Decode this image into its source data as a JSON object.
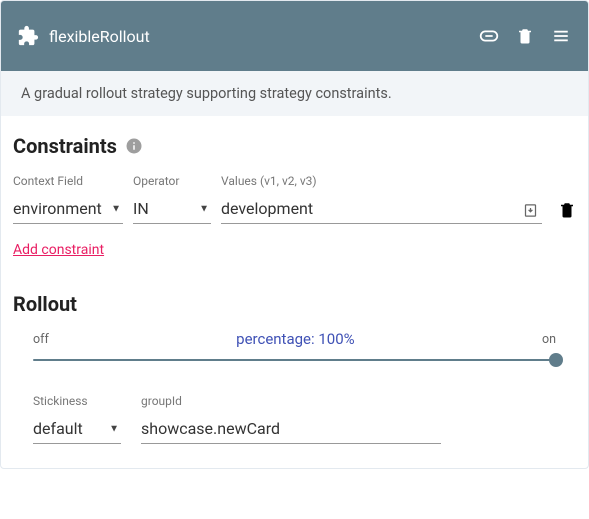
{
  "header": {
    "title": "flexibleRollout"
  },
  "description": "A gradual rollout strategy supporting strategy constraints.",
  "constraints": {
    "title": "Constraints",
    "labels": {
      "contextField": "Context Field",
      "operator": "Operator",
      "values": "Values (v1, v2, v3)"
    },
    "row": {
      "contextField": "environment",
      "operator": "IN",
      "values": "development"
    },
    "addLink": "Add constraint"
  },
  "rollout": {
    "title": "Rollout",
    "offLabel": "off",
    "onLabel": "on",
    "percentageLabel": "percentage: 100%",
    "percentage": 100,
    "fields": {
      "stickinessLabel": "Stickiness",
      "stickinessValue": "default",
      "groupIdLabel": "groupId",
      "groupIdValue": "showcase.newCard"
    }
  }
}
